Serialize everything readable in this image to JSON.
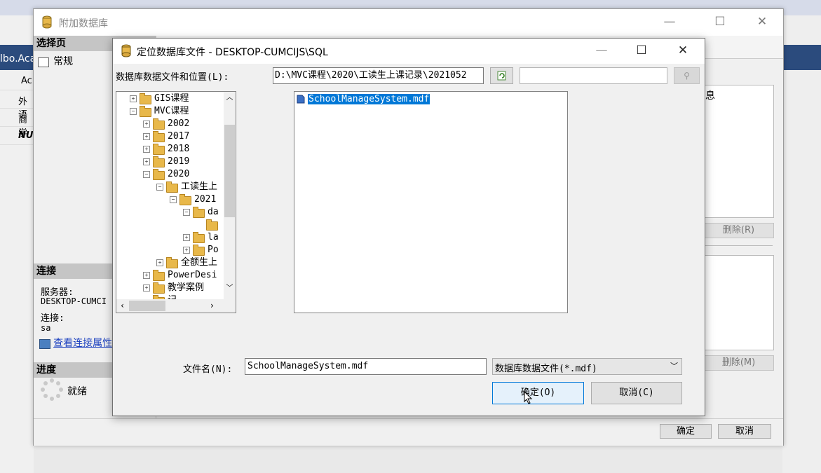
{
  "background": {
    "left_tab_text": "lbo.Aca",
    "grid_header": "Ac",
    "grid_rows": [
      "外语",
      "商学",
      "NU"
    ]
  },
  "outer_dialog": {
    "title": "附加数据库",
    "select_page_header": "选择页",
    "pages": [
      "常规"
    ],
    "connection_header": "连接",
    "server_label": "服务器:",
    "server_value": "DESKTOP-CUMCI",
    "connect_label": "连接:",
    "connect_value": "sa",
    "view_connection_link": "查看连接属性",
    "progress_header": "进度",
    "progress_status": "就绪",
    "info_text": "息",
    "remove_button_1": "删除(R)",
    "remove_button_2": "删除(M)",
    "ok_button": "确定",
    "cancel_button": "取消"
  },
  "inner_dialog": {
    "title": "定位数据库文件 - DESKTOP-CUMCIJS\\SQL",
    "location_label": "数据库数据文件和位置(L):",
    "location_value": "D:\\MVC课程\\2020\\工读生上课记录\\2021052",
    "search_value": "",
    "tree": [
      {
        "label": "GIS课程",
        "level": 0,
        "expander": "+"
      },
      {
        "label": "MVC课程",
        "level": 0,
        "expander": "-"
      },
      {
        "label": "2002",
        "level": 1,
        "expander": "+"
      },
      {
        "label": "2017",
        "level": 1,
        "expander": "+"
      },
      {
        "label": "2018",
        "level": 1,
        "expander": "+"
      },
      {
        "label": "2019",
        "level": 1,
        "expander": "+"
      },
      {
        "label": "2020",
        "level": 1,
        "expander": "-"
      },
      {
        "label": "工读生上",
        "level": 2,
        "expander": "-"
      },
      {
        "label": "2021",
        "level": 3,
        "expander": "-"
      },
      {
        "label": "da",
        "level": 4,
        "expander": "-"
      },
      {
        "label": "",
        "level": 5,
        "expander": ""
      },
      {
        "label": "la",
        "level": 4,
        "expander": "+"
      },
      {
        "label": "Po",
        "level": 4,
        "expander": "+"
      },
      {
        "label": "全额生上",
        "level": 2,
        "expander": "+"
      },
      {
        "label": "PowerDesi",
        "level": 1,
        "expander": "+"
      },
      {
        "label": "教学案例",
        "level": 1,
        "expander": "+"
      },
      {
        "label": "记",
        "level": 1,
        "expander": ""
      }
    ],
    "files": [
      {
        "name": "SchoolManageSystem.mdf",
        "selected": true
      }
    ],
    "filename_label": "文件名(N):",
    "filename_value": "SchoolManageSystem.mdf",
    "filter_value": "数据库数据文件(*.mdf)",
    "ok_button": "确定(O)",
    "cancel_button": "取消(C)"
  },
  "colors": {
    "selection": "#0078d7",
    "folder": "#e8b84a",
    "section_header": "#c5c5c5",
    "ok_highlight": "#e5f1fb",
    "ok_border": "#0078d7"
  }
}
